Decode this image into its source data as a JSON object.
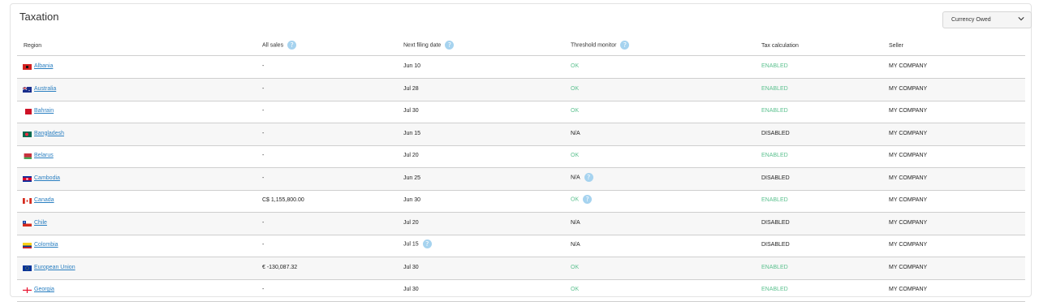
{
  "page": {
    "title": "Taxation"
  },
  "currency_select": {
    "value": "Currency Owed"
  },
  "columns": {
    "region": "Region",
    "all_sales": "All sales",
    "next_filing": "Next filing date",
    "threshold": "Threshold monitor",
    "tax_calc": "Tax calculation",
    "seller": "Seller"
  },
  "help_glyph": "?",
  "rows": [
    {
      "region": "Albania",
      "flag": "albania",
      "all_sales": "-",
      "next_filing": "Jun 10",
      "filing_help": false,
      "threshold": "OK",
      "threshold_help": false,
      "tax_calc": "ENABLED",
      "seller": "MY COMPANY"
    },
    {
      "region": "Australia",
      "flag": "australia",
      "all_sales": "-",
      "next_filing": "Jul 28",
      "filing_help": false,
      "threshold": "OK",
      "threshold_help": false,
      "tax_calc": "ENABLED",
      "seller": "MY COMPANY"
    },
    {
      "region": "Bahrain",
      "flag": "bahrain",
      "all_sales": "-",
      "next_filing": "Jul 30",
      "filing_help": false,
      "threshold": "OK",
      "threshold_help": false,
      "tax_calc": "ENABLED",
      "seller": "MY COMPANY"
    },
    {
      "region": "Bangladesh",
      "flag": "bangladesh",
      "all_sales": "-",
      "next_filing": "Jun 15",
      "filing_help": false,
      "threshold": "N/A",
      "threshold_help": false,
      "tax_calc": "DISABLED",
      "seller": "MY COMPANY"
    },
    {
      "region": "Belarus",
      "flag": "belarus",
      "all_sales": "-",
      "next_filing": "Jul 20",
      "filing_help": false,
      "threshold": "OK",
      "threshold_help": false,
      "tax_calc": "ENABLED",
      "seller": "MY COMPANY"
    },
    {
      "region": "Cambodia",
      "flag": "cambodia",
      "all_sales": "-",
      "next_filing": "Jun 25",
      "filing_help": false,
      "threshold": "N/A",
      "threshold_help": true,
      "tax_calc": "DISABLED",
      "seller": "MY COMPANY"
    },
    {
      "region": "Canada",
      "flag": "canada",
      "all_sales": "C$ 1,155,800.00",
      "next_filing": "Jun 30",
      "filing_help": false,
      "threshold": "OK",
      "threshold_help": true,
      "tax_calc": "ENABLED",
      "seller": "MY COMPANY"
    },
    {
      "region": "Chile",
      "flag": "chile",
      "all_sales": "-",
      "next_filing": "Jul 20",
      "filing_help": false,
      "threshold": "N/A",
      "threshold_help": false,
      "tax_calc": "DISABLED",
      "seller": "MY COMPANY"
    },
    {
      "region": "Colombia",
      "flag": "colombia",
      "all_sales": "-",
      "next_filing": "Jul 15",
      "filing_help": true,
      "threshold": "N/A",
      "threshold_help": false,
      "tax_calc": "DISABLED",
      "seller": "MY COMPANY"
    },
    {
      "region": "European Union",
      "flag": "eu",
      "all_sales": "€ -130,087.32",
      "next_filing": "Jul 30",
      "filing_help": false,
      "threshold": "OK",
      "threshold_help": false,
      "tax_calc": "ENABLED",
      "seller": "MY COMPANY"
    },
    {
      "region": "Georgia",
      "flag": "georgia",
      "all_sales": "-",
      "next_filing": "Jul 30",
      "filing_help": false,
      "threshold": "OK",
      "threshold_help": false,
      "tax_calc": "ENABLED",
      "seller": "MY COMPANY"
    }
  ]
}
